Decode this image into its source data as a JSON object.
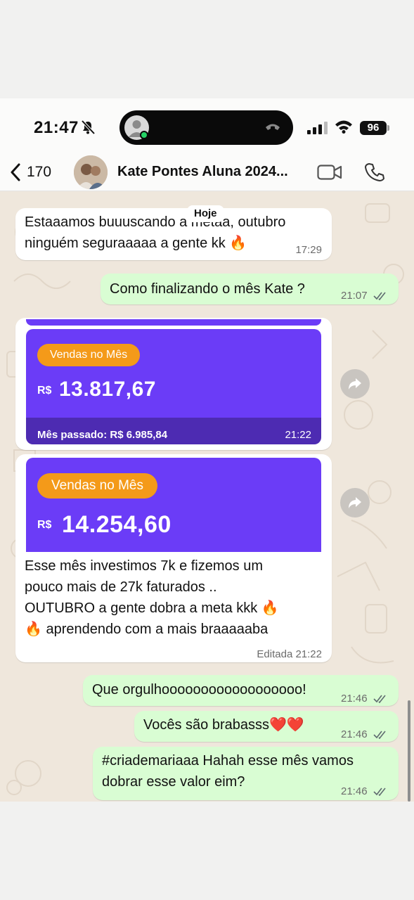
{
  "status_bar": {
    "time": "21:47",
    "battery": "96"
  },
  "header": {
    "back_count": "170",
    "contact_name": "Kate Pontes Aluna 2024..."
  },
  "chat": {
    "date_label": "Hoje",
    "msg1": {
      "text": "Estaaamos buuuscando a metaa, outubro ninguém seguraaaaa a gente kk 🔥",
      "time": "17:29"
    },
    "msg2": {
      "text": "Como finalizando o mês Kate ?",
      "time": "21:07"
    },
    "img1": {
      "badge": "Vendas no Mês",
      "currency": "R$",
      "amount": "13.817,67",
      "footer": "Mês passado: R$ 6.985,84",
      "time": "21:22"
    },
    "img2": {
      "badge": "Vendas no Mês",
      "currency": "R$",
      "amount": "14.254,60",
      "caption_lines": [
        "Esse mês investimos 7k e fizemos um",
        "pouco mais de 27k faturados ..",
        "OUTUBRO a gente dobra a meta kkk 🔥",
        "🔥  aprendendo com a mais braaaaaba"
      ],
      "edited_label": "Editada",
      "time": "21:22"
    },
    "msg3": {
      "text": "Que orgulhoooooooooooooooooo!",
      "time": "21:46"
    },
    "msg4": {
      "text": "Vocês são brabasss❤️❤️",
      "time": "21:46"
    },
    "msg5": {
      "lines": [
        "#criademariaaa Hahah esse mês vamos",
        "dobrar esse valor eim?"
      ],
      "time": "21:46"
    }
  },
  "colors": {
    "outgoing": "#d9fdd3",
    "card": "#6b3cf7",
    "badge": "#f49a19",
    "read_ticks": "#5e6b6f"
  }
}
